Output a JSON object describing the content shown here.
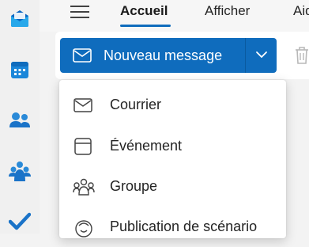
{
  "header": {
    "tabs": [
      {
        "label": "Accueil",
        "selected": true
      },
      {
        "label": "Afficher"
      },
      {
        "label": "Aid"
      }
    ]
  },
  "rail": {
    "items": [
      {
        "icon": "mail-app-icon"
      },
      {
        "icon": "calendar-app-icon"
      },
      {
        "icon": "people-app-icon"
      },
      {
        "icon": "groups-app-icon"
      },
      {
        "icon": "todo-app-icon"
      }
    ]
  },
  "toolbar": {
    "new_message_label": "Nouveau message",
    "accent_color": "#0f6cbd"
  },
  "new_menu": {
    "items": [
      {
        "label": "Courrier",
        "icon": "mail-icon"
      },
      {
        "label": "Événement",
        "icon": "calendar-event-icon"
      },
      {
        "label": "Groupe",
        "icon": "group-icon"
      },
      {
        "label": "Publication de scénario",
        "icon": "story-post-icon"
      }
    ]
  }
}
